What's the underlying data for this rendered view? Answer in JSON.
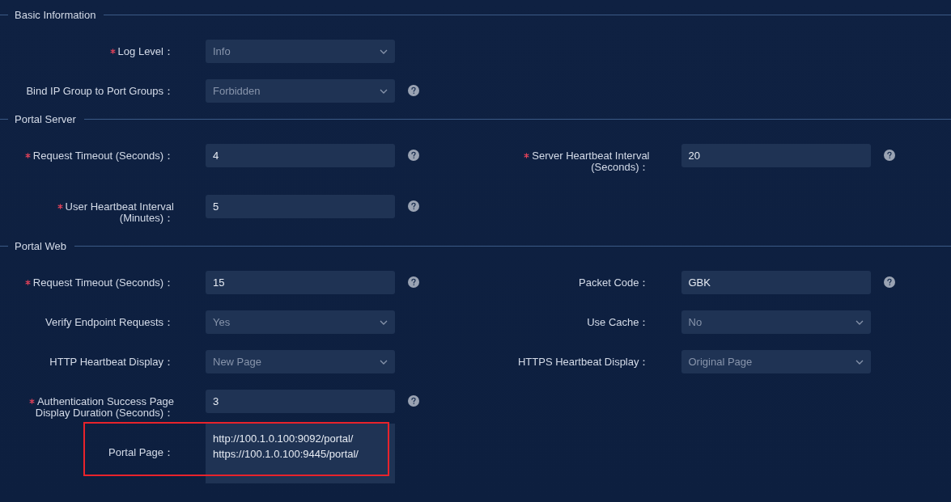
{
  "sections": [
    {
      "title": "Basic Information",
      "rows": [
        {
          "fields": [
            {
              "label": "Log Level：",
              "required": true,
              "kind": "select",
              "value": "Info",
              "help": false,
              "highlighted": false
            }
          ]
        },
        {
          "fields": [
            {
              "label": "Bind IP Group to Port Groups：",
              "required": false,
              "kind": "select",
              "value": "Forbidden",
              "help": true,
              "highlighted": false
            }
          ]
        }
      ]
    },
    {
      "title": "Portal Server",
      "rows": [
        {
          "fields": [
            {
              "label": "Request Timeout (Seconds)：",
              "required": true,
              "kind": "input",
              "value": "4",
              "help": true,
              "highlighted": false
            },
            {
              "label": "Server Heartbeat Interval (Seconds)：",
              "required": true,
              "kind": "input",
              "value": "20",
              "help": true,
              "highlighted": false
            }
          ]
        },
        {
          "fields": [
            {
              "label": "User Heartbeat Interval (Minutes)：",
              "required": true,
              "kind": "input",
              "value": "5",
              "help": true,
              "highlighted": false
            }
          ]
        }
      ]
    },
    {
      "title": "Portal Web",
      "rows": [
        {
          "fields": [
            {
              "label": "Request Timeout (Seconds)：",
              "required": true,
              "kind": "input",
              "value": "15",
              "help": true,
              "highlighted": false
            },
            {
              "label": "Packet Code：",
              "required": false,
              "kind": "input",
              "value": "GBK",
              "help": true,
              "highlighted": false
            }
          ]
        },
        {
          "fields": [
            {
              "label": "Verify Endpoint Requests：",
              "required": false,
              "kind": "select",
              "value": "Yes",
              "help": false,
              "highlighted": false
            },
            {
              "label": "Use Cache：",
              "required": false,
              "kind": "select",
              "value": "No",
              "help": false,
              "highlighted": false
            }
          ]
        },
        {
          "fields": [
            {
              "label": "HTTP Heartbeat Display：",
              "required": false,
              "kind": "select",
              "value": "New Page",
              "help": false,
              "highlighted": false
            },
            {
              "label": "HTTPS Heartbeat Display：",
              "required": false,
              "kind": "select",
              "value": "Original Page",
              "help": false,
              "highlighted": false
            }
          ]
        },
        {
          "fields": [
            {
              "label": "Authentication Success Page Display Duration (Seconds)：",
              "required": true,
              "kind": "input",
              "value": "3",
              "help": true,
              "highlighted": false
            }
          ]
        },
        {
          "fields": [
            {
              "label": "Portal Page：",
              "required": false,
              "kind": "textarea",
              "value": "http://100.1.0.100:9092/portal/\nhttps://100.1.0.100:9445/portal/",
              "help": false,
              "highlighted": true
            }
          ]
        }
      ]
    }
  ]
}
